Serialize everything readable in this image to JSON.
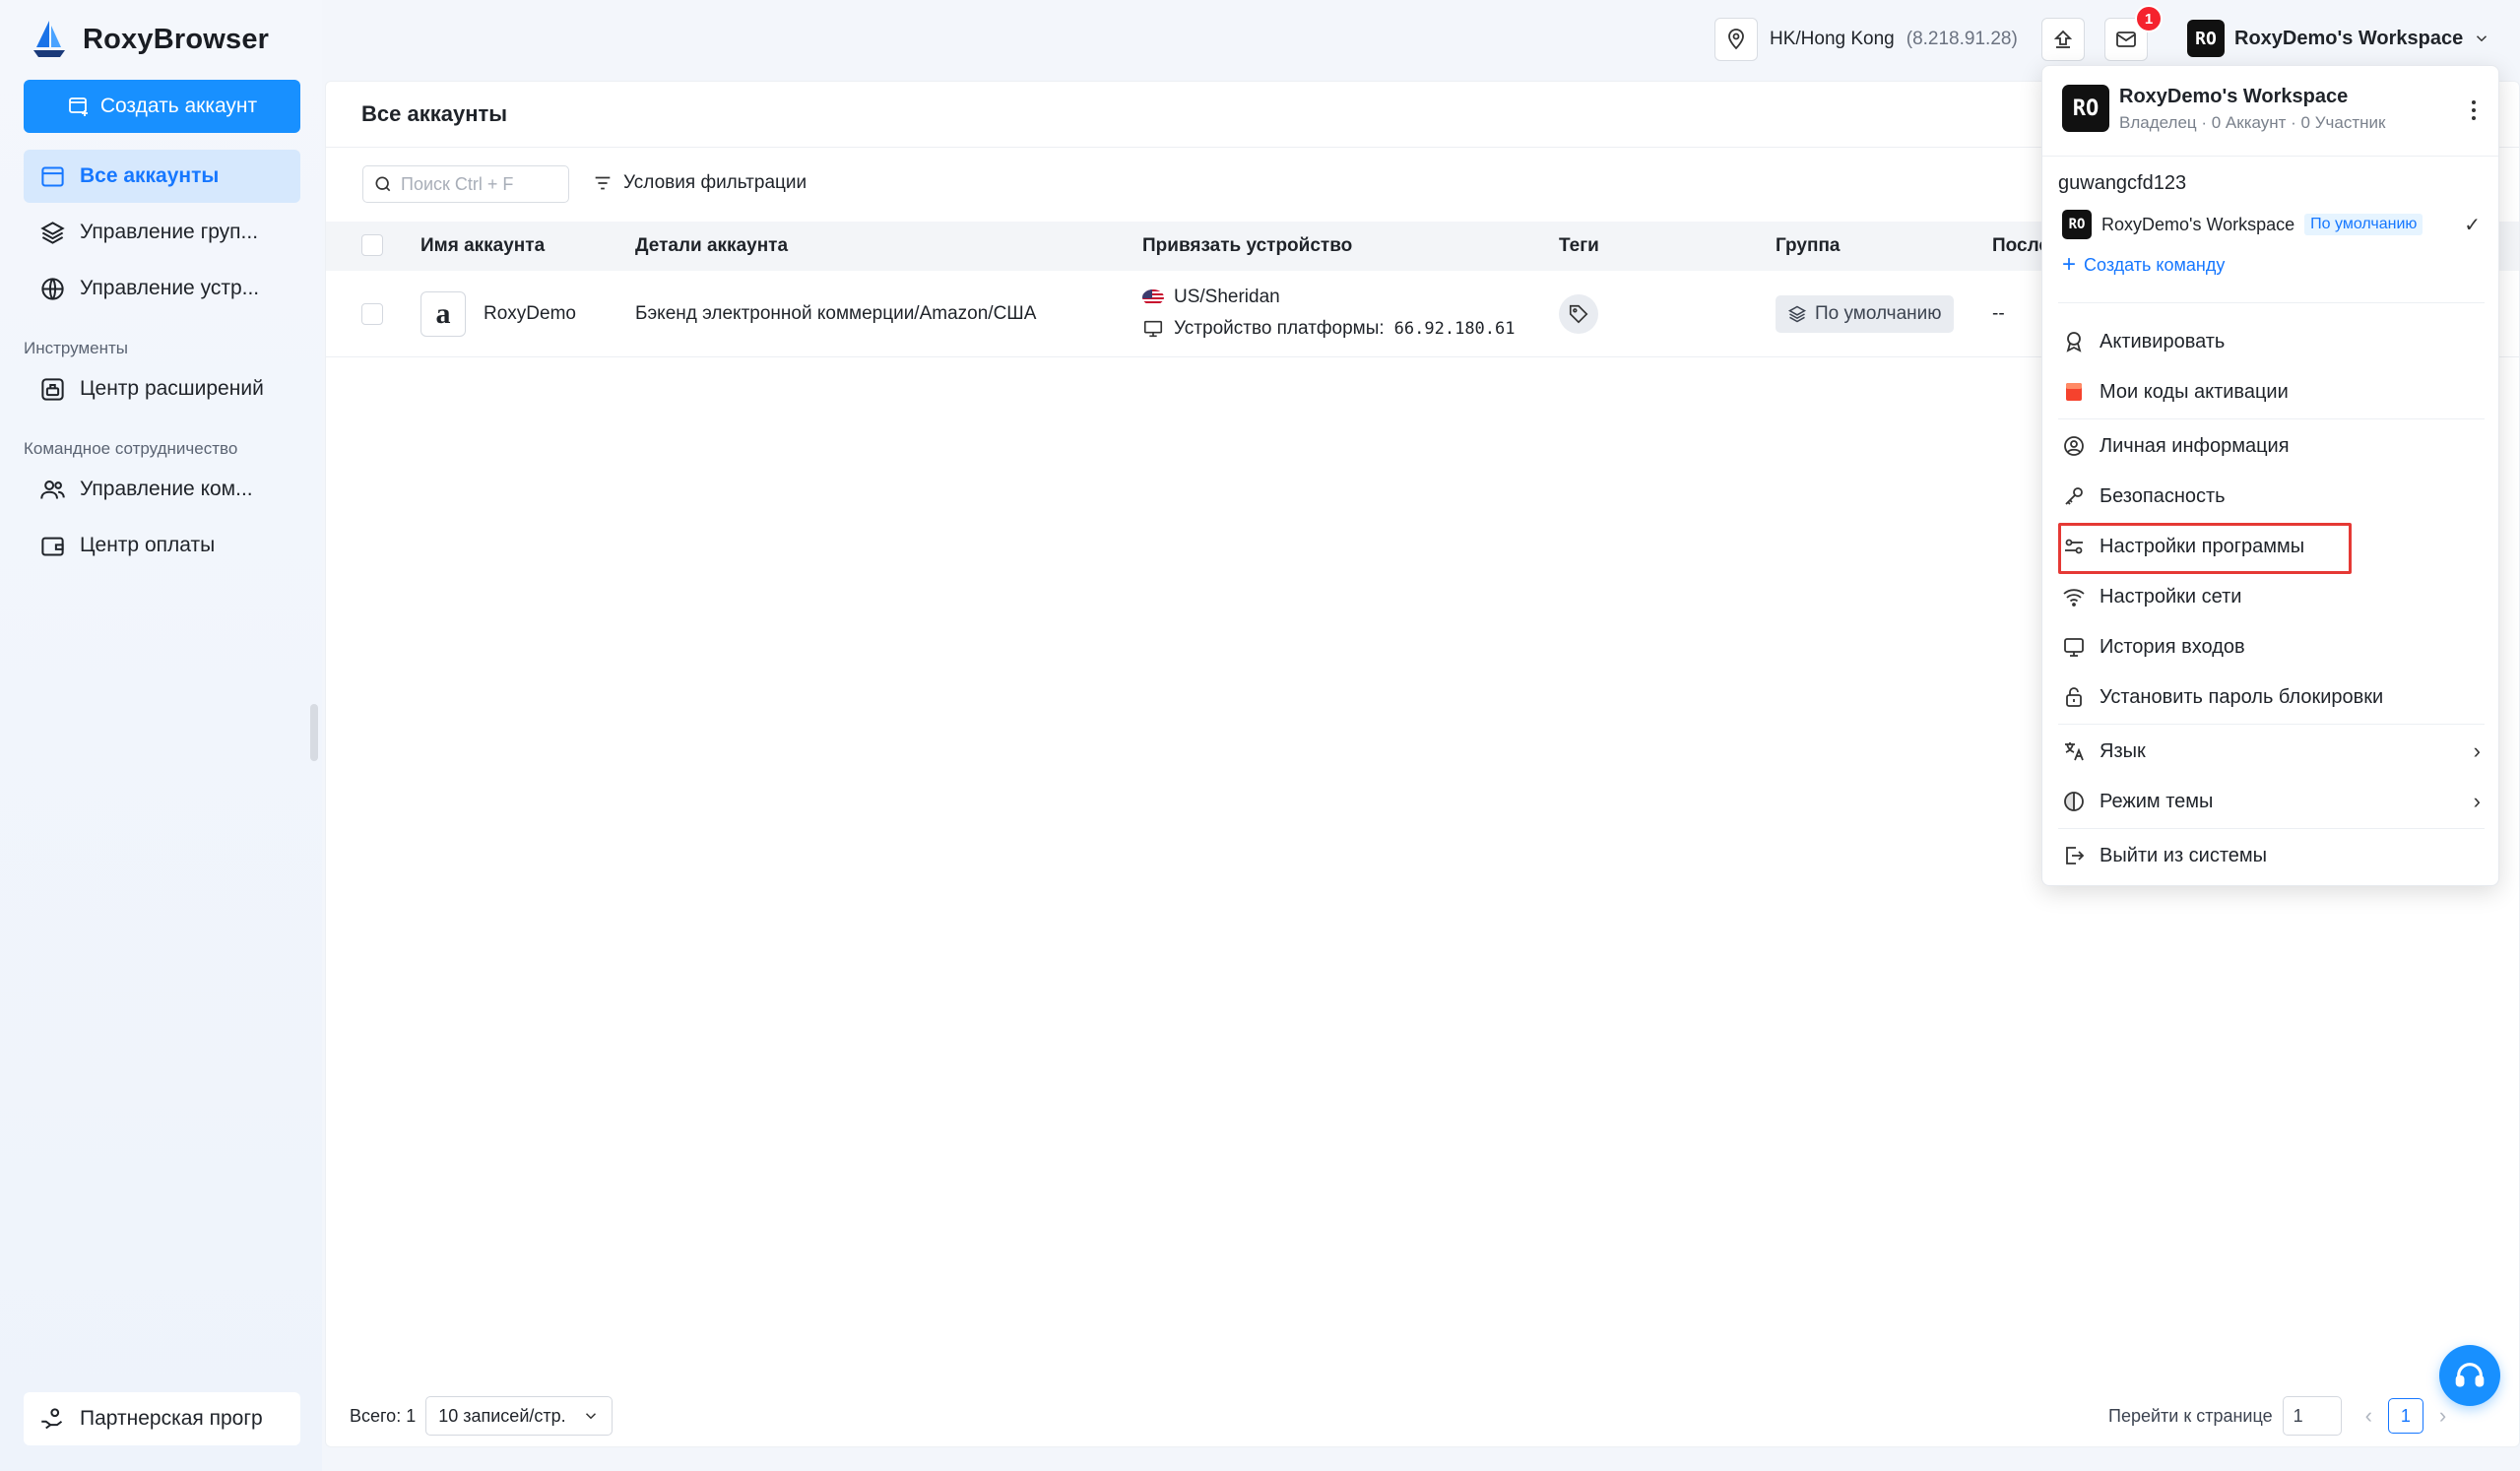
{
  "app": {
    "name": "RoxyBrowser"
  },
  "sidebar": {
    "create_label": "Создать аккаунт",
    "items": [
      {
        "label": "Все аккаунты"
      },
      {
        "label": "Управление груп..."
      },
      {
        "label": "Управление устр..."
      }
    ],
    "tools_title": "Инструменты",
    "tools_items": [
      {
        "label": "Центр расширений"
      }
    ],
    "team_title": "Командное сотрудничество",
    "team_items": [
      {
        "label": "Управление ком..."
      },
      {
        "label": "Центр оплаты"
      }
    ],
    "partner_label": "Партнерская прогр"
  },
  "topbar": {
    "location": "HK/Hong Kong",
    "ip": "(8.218.91.28)",
    "mail_badge": "1",
    "workspace_avatar": "RO",
    "workspace_name": "RoxyDemo's Workspace"
  },
  "main": {
    "title": "Все аккаунты",
    "search_placeholder": "Поиск Ctrl + F",
    "filter_label": "Условия фильтрации",
    "columns": [
      "Имя аккаунта",
      "Детали аккаунта",
      "Привязать устройство",
      "Теги",
      "Группа",
      "После"
    ],
    "rows": [
      {
        "icon_letter": "a",
        "name": "RoxyDemo",
        "details": "Бэкенд электронной коммерции/Amazon/США",
        "device_location": "US/Sheridan",
        "device_label": "Устройство платформы:",
        "device_ip": "66.92.180.61",
        "group": "По умолчанию",
        "last": "--"
      }
    ],
    "total_label": "Всего: 1",
    "page_size": "10 записей/стр.",
    "goto_label": "Перейти к странице",
    "goto_value": "1",
    "current_page": "1"
  },
  "dropdown": {
    "avatar": "RO",
    "workspace_name": "RoxyDemo's Workspace",
    "workspace_sub": "Владелец · 0 Аккаунт · 0 Участник",
    "username": "guwangcfd123",
    "ws_avatar": "RO",
    "ws_name": "RoxyDemo's Workspace",
    "ws_default": "По умолчанию",
    "create_team": "Создать команду",
    "items": {
      "activate": "Активировать",
      "codes": "Мои коды активации",
      "profile": "Личная информация",
      "security": "Безопасность",
      "settings": "Настройки программы",
      "network": "Настройки сети",
      "history": "История входов",
      "lock": "Установить пароль блокировки",
      "language": "Язык",
      "theme": "Режим темы",
      "logout": "Выйти из системы"
    }
  },
  "colors": {
    "accent": "#1890ff",
    "highlight": "#e53935",
    "badge": "#f5222d"
  }
}
